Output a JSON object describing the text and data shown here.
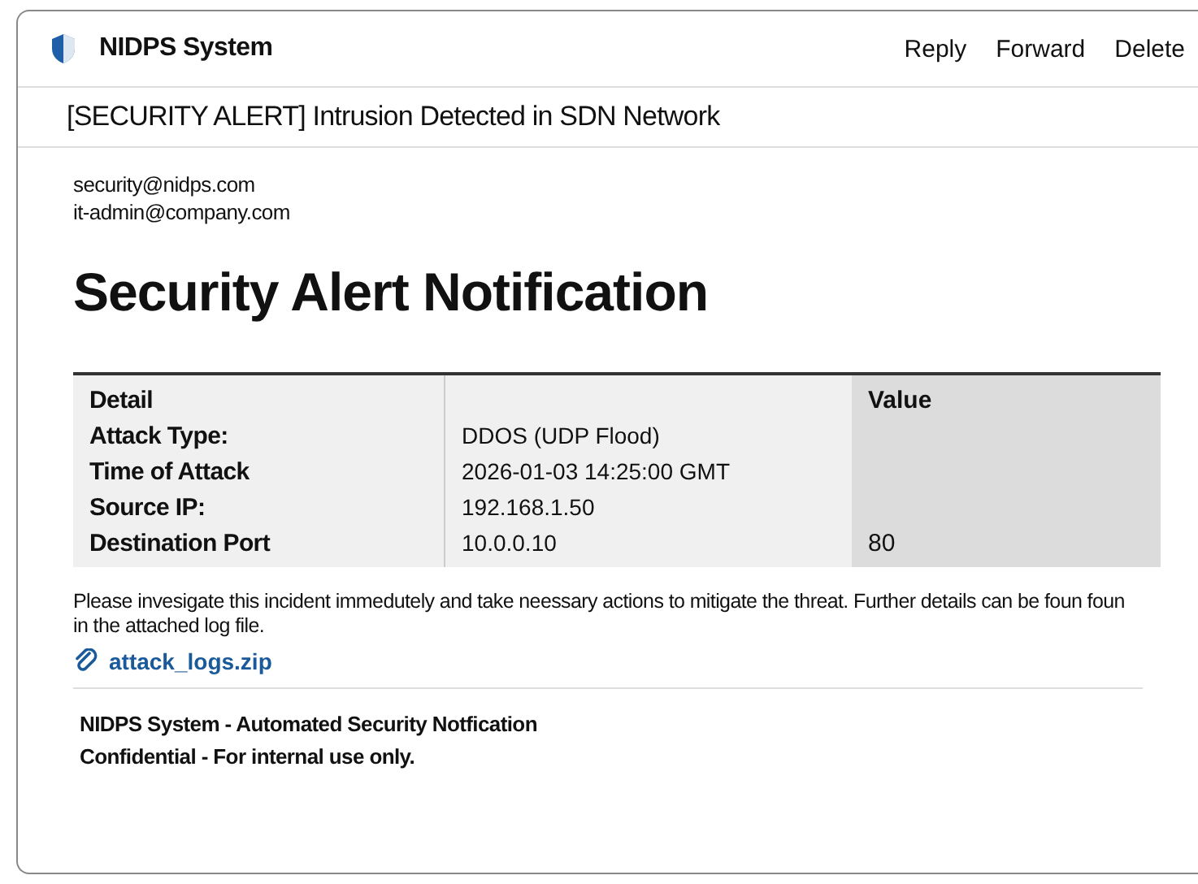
{
  "app": {
    "title": "NIDPS System",
    "actions": [
      "Reply",
      "Forward",
      "Delete"
    ]
  },
  "subject": "[SECURITY ALERT] Intrusion Detected in SDN Network",
  "from": "security@nidps.com",
  "to": "it-admin@company.com",
  "heading": "Security Alert Notification",
  "table": {
    "header_column_1": "Detail",
    "header_column_3": "Value",
    "rows": [
      {
        "label": "Attack Type:",
        "value": "DDOS (UDP Flood)"
      },
      {
        "label": "Time of Attack",
        "value": "2026-01-03 14:25:00 GMT"
      },
      {
        "label": "Source IP:",
        "value": "192.168.1.50"
      },
      {
        "label": "Destination Port",
        "value": "10.0.0.10",
        "column_3": "80"
      }
    ]
  },
  "message": "Please invesigate this incident immedutely and take neessary actions to mitigate the threat. Further details can be foun foun in the attached log file.",
  "attachment": "attack_logs.zip",
  "footer": [
    "NIDPS System - Automated Security Notfication",
    "Confidential - For internal use only."
  ]
}
